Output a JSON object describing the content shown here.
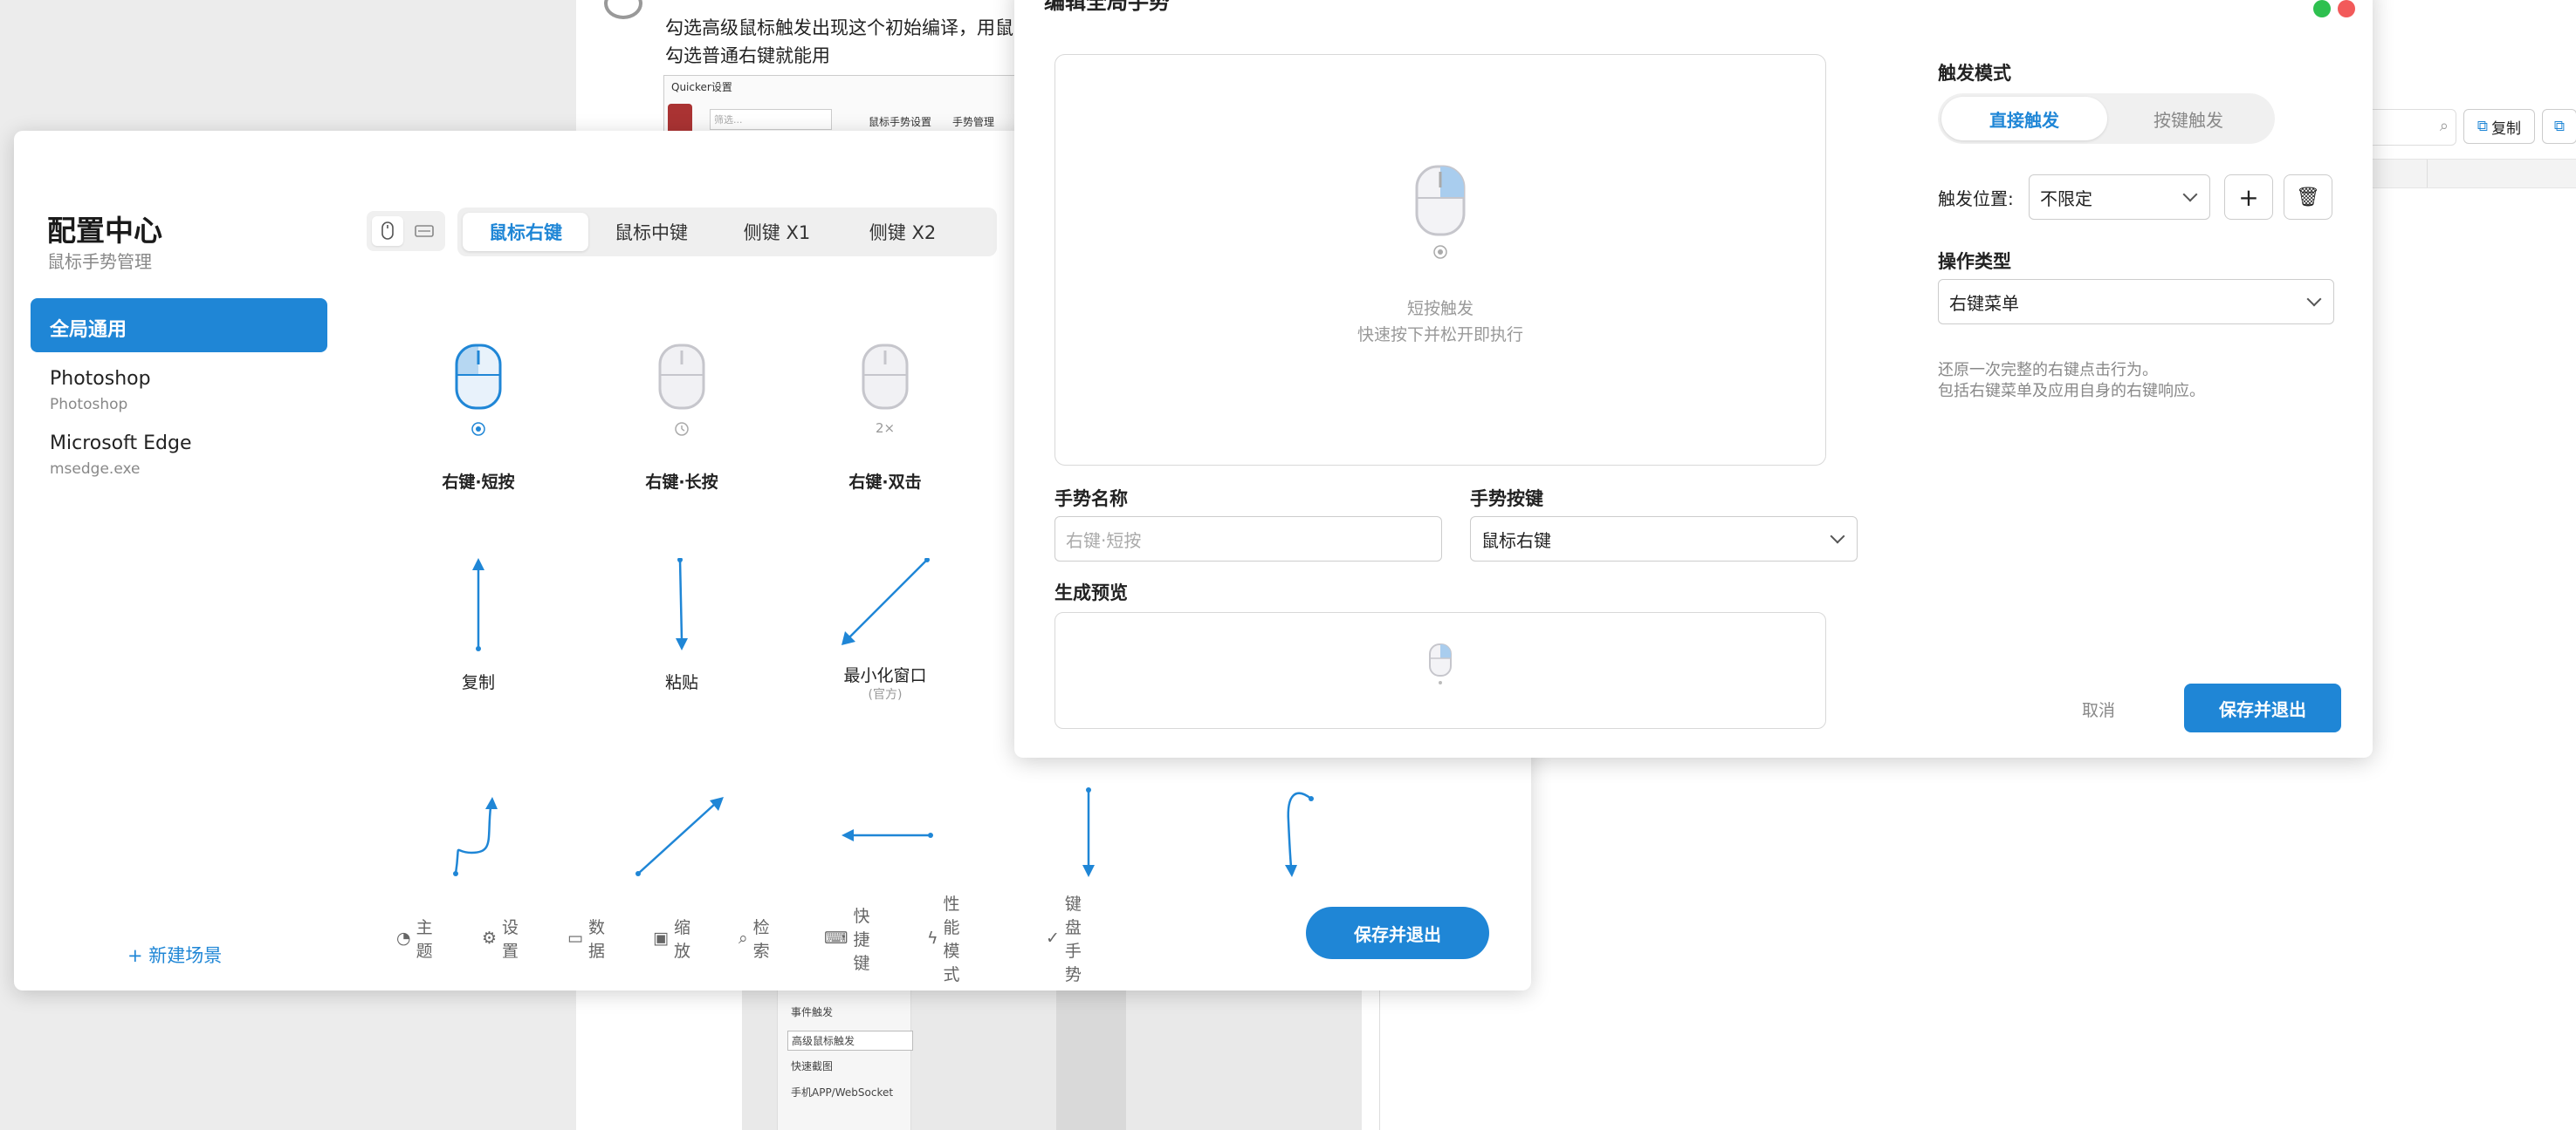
{
  "background_doc": {
    "line1": "勾选高级鼠标触发出现这个初始编译，用鼠",
    "line2": "勾选普通右键就能用",
    "shot_title": "Quicker设置",
    "shot_search": "筛选...",
    "shot_tab1": "鼠标手势设置",
    "shot_tab2": "手势管理",
    "sidebar_items": [
      "事件触发",
      "高级鼠标触发",
      "快速截图",
      "手机APP/WebSocket"
    ]
  },
  "background_right": {
    "copy_label": "复制"
  },
  "config": {
    "title": "配置中心",
    "subtitle": "鼠标手势管理",
    "scenes": [
      {
        "name": "全局通用",
        "sub": ""
      },
      {
        "name": "Photoshop",
        "sub": "Photoshop"
      },
      {
        "name": "Microsoft Edge",
        "sub": "msedge.exe"
      }
    ],
    "new_scene": "新建场景",
    "tabs": [
      "鼠标右键",
      "鼠标中键",
      "侧键 X1",
      "侧键 X2"
    ],
    "row1": [
      {
        "label": "右键·短按",
        "hint": "◉"
      },
      {
        "label": "右键·长按",
        "hint": "◷"
      },
      {
        "label": "右键·双击",
        "hint": "2×"
      }
    ],
    "row2": [
      {
        "label": "复制",
        "sub": ""
      },
      {
        "label": "粘贴",
        "sub": ""
      },
      {
        "label": "最小化窗口",
        "sub": "(官方)"
      }
    ],
    "bottom": [
      "主题",
      "设置",
      "数据",
      "缩放",
      "检索",
      "快捷键",
      "性能模式",
      "键盘手势"
    ],
    "save": "保存并退出"
  },
  "editor": {
    "title": "编辑全局手势",
    "canvas_line1": "短按触发",
    "canvas_line2": "快速按下并松开即执行",
    "name_label": "手势名称",
    "name_placeholder": "右键·短按",
    "button_label": "手势按键",
    "button_value": "鼠标右键",
    "preview_label": "生成预览",
    "trigger_mode_label": "触发模式",
    "trigger_modes": [
      "直接触发",
      "按键触发"
    ],
    "position_label": "触发位置:",
    "position_value": "不限定",
    "op_type_label": "操作类型",
    "op_type_value": "右键菜单",
    "desc1": "还原一次完整的右键点击行为。",
    "desc2": "包括右键菜单及应用自身的右键响应。",
    "cancel": "取消",
    "save": "保存并退出",
    "accent": "#1f86d6"
  }
}
